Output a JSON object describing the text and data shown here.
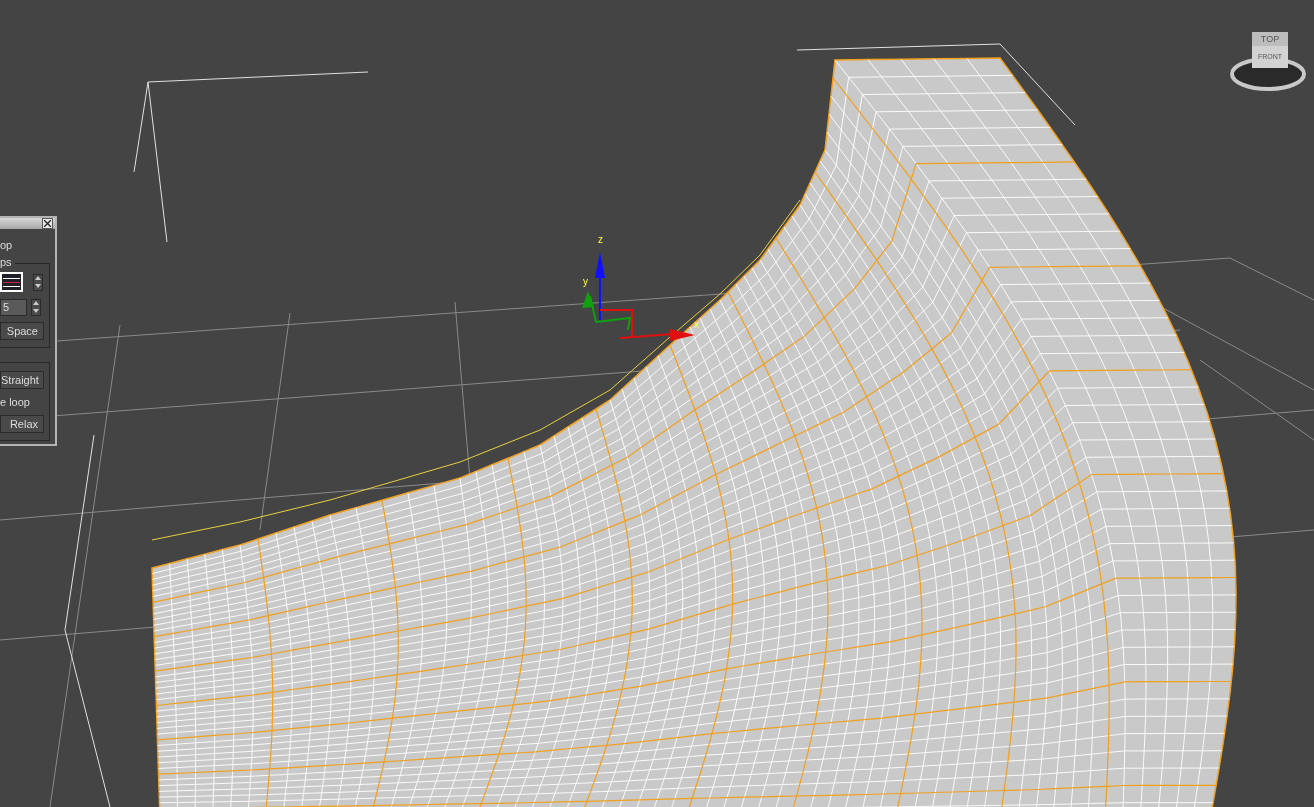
{
  "viewport": {
    "viewcube": {
      "top_label": "TOP",
      "front_label": "FRONT"
    },
    "gizmo": {
      "axes": [
        {
          "kind": "z",
          "label": "z",
          "color": "#1010ff"
        },
        {
          "kind": "y",
          "label": "y",
          "color": "#10a010"
        },
        {
          "kind": "x",
          "label": "x",
          "color": "#e01010"
        }
      ]
    }
  },
  "panel": {
    "items": [
      {
        "kind": "label",
        "text": "op"
      },
      {
        "kind": "group",
        "label": "ps",
        "rows": [
          {
            "kind": "swatch"
          },
          {
            "kind": "spinner",
            "value": "5"
          },
          {
            "kind": "button",
            "text": "Space"
          }
        ]
      },
      {
        "kind": "group",
        "rows": [
          {
            "kind": "button",
            "text": "Straight"
          },
          {
            "kind": "label",
            "text": "e loop"
          },
          {
            "kind": "button",
            "text": "Relax"
          }
        ]
      }
    ]
  }
}
